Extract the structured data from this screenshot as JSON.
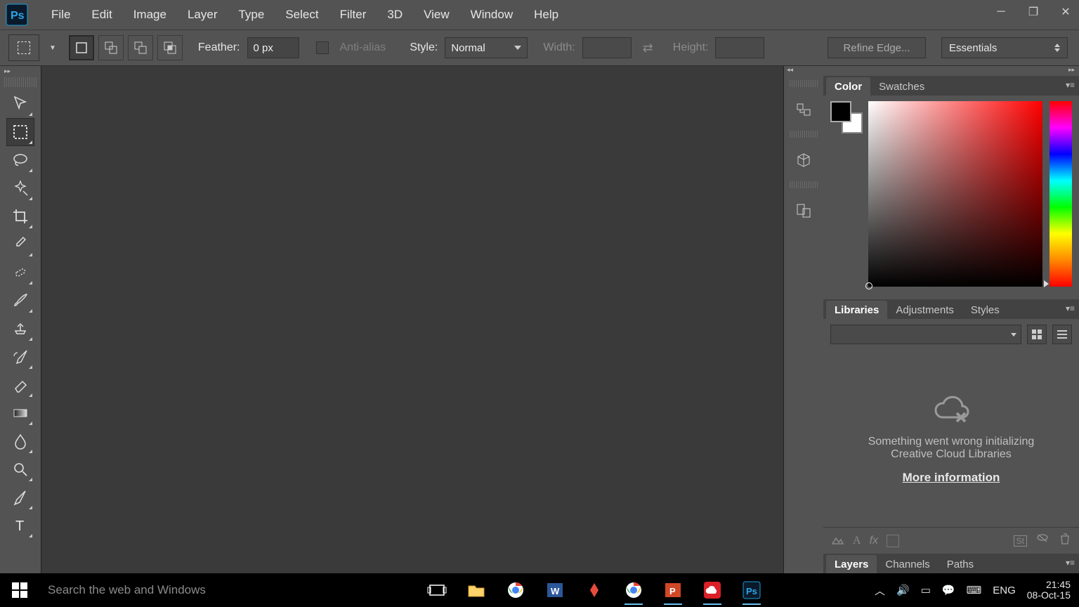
{
  "menu": {
    "items": [
      "File",
      "Edit",
      "Image",
      "Layer",
      "Type",
      "Select",
      "Filter",
      "3D",
      "View",
      "Window",
      "Help"
    ]
  },
  "options": {
    "feather_label": "Feather:",
    "feather_value": "0 px",
    "antialias_label": "Anti-alias",
    "style_label": "Style:",
    "style_value": "Normal",
    "width_label": "Width:",
    "height_label": "Height:",
    "refine_label": "Refine Edge...",
    "workspace": "Essentials"
  },
  "tools": [
    "move",
    "rect-marquee",
    "lasso",
    "magic-wand",
    "crop",
    "eyedropper",
    "heal",
    "brush",
    "clone",
    "history-brush",
    "eraser",
    "gradient",
    "blur",
    "zoom",
    "pen",
    "type"
  ],
  "active_tool": "rect-marquee",
  "dock_icons": [
    "history",
    "3d",
    "properties"
  ],
  "panels": {
    "color_tabs": [
      "Color",
      "Swatches"
    ],
    "color_active": "Color",
    "lib_tabs": [
      "Libraries",
      "Adjustments",
      "Styles"
    ],
    "lib_active": "Libraries",
    "lib_error_l1": "Something went wrong initializing",
    "lib_error_l2": "Creative Cloud Libraries",
    "lib_link": "More information",
    "layers_tabs": [
      "Layers",
      "Channels",
      "Paths"
    ],
    "layers_active": "Layers"
  },
  "taskbar": {
    "search_placeholder": "Search the web and Windows",
    "lang": "ENG",
    "time": "21:45",
    "date": "08-Oct-15"
  }
}
